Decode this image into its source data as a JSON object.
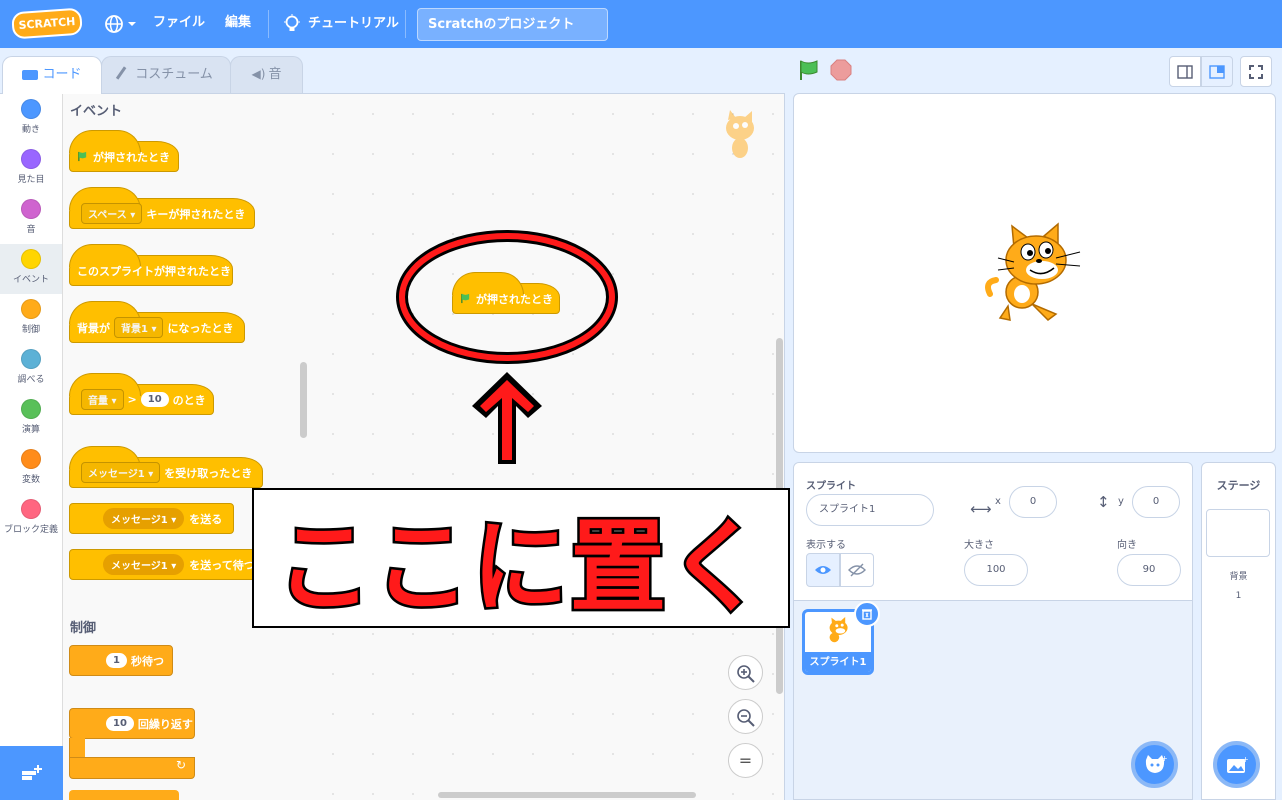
{
  "menubar": {
    "logo": "SCRATCH",
    "file": "ファイル",
    "edit": "編集",
    "tutorial": "チュートリアル",
    "project_title": "Scratchのプロジェクト"
  },
  "tabs": {
    "code": "コード",
    "costumes": "コスチューム",
    "sounds": "音"
  },
  "categories": [
    {
      "label": "動き",
      "color": "#4c97ff"
    },
    {
      "label": "見た目",
      "color": "#9966ff"
    },
    {
      "label": "音",
      "color": "#cf63cf"
    },
    {
      "label": "イベント",
      "color": "#ffd500"
    },
    {
      "label": "制御",
      "color": "#ffab19"
    },
    {
      "label": "調べる",
      "color": "#5cb1d6"
    },
    {
      "label": "演算",
      "color": "#59c059"
    },
    {
      "label": "変数",
      "color": "#ff8c1a"
    },
    {
      "label": "ブロック定義",
      "color": "#ff6680"
    }
  ],
  "palette": {
    "events_heading": "イベント",
    "flag_clicked": "が押されたとき",
    "key_dd": "スペース",
    "key_pressed": "キーが押されたとき",
    "sprite_clicked": "このスプライトが押されたとき",
    "backdrop_prefix": "背景が",
    "backdrop_dd": "背景1",
    "backdrop_suffix": "になったとき",
    "loudness_dd": "音量",
    "gt": ">",
    "loudness_val": "10",
    "loudness_suffix": "のとき",
    "msg_dd": "メッセージ1",
    "msg_received": "を受け取ったとき",
    "broadcast": "を送る",
    "broadcast_wait": "を送って待つ",
    "control_heading": "制御",
    "wait_val": "1",
    "wait_suffix": "秒待つ",
    "repeat_val": "10",
    "repeat_suffix": "回繰り返す"
  },
  "workspace": {
    "placed_block": "が押されたとき",
    "zoom_in": "+",
    "zoom_out": "−",
    "zoom_reset": "="
  },
  "annotation": {
    "text": "ここに置く",
    "color": "#ff1a1a"
  },
  "sprite_info": {
    "sprite_label": "スプライト",
    "sprite_name": "スプライト1",
    "x_label": "x",
    "x_value": "0",
    "y_label": "y",
    "y_value": "0",
    "show_label": "表示する",
    "size_label": "大きさ",
    "size_value": "100",
    "direction_label": "向き",
    "direction_value": "90"
  },
  "sprite_list": [
    {
      "name": "スプライト1"
    }
  ],
  "stage_pane": {
    "title": "ステージ",
    "backdrops_label": "背景",
    "backdrops_count": "1"
  },
  "colors": {
    "accent": "#4c97ff",
    "events": "#ffbf00",
    "control": "#ffab19"
  }
}
